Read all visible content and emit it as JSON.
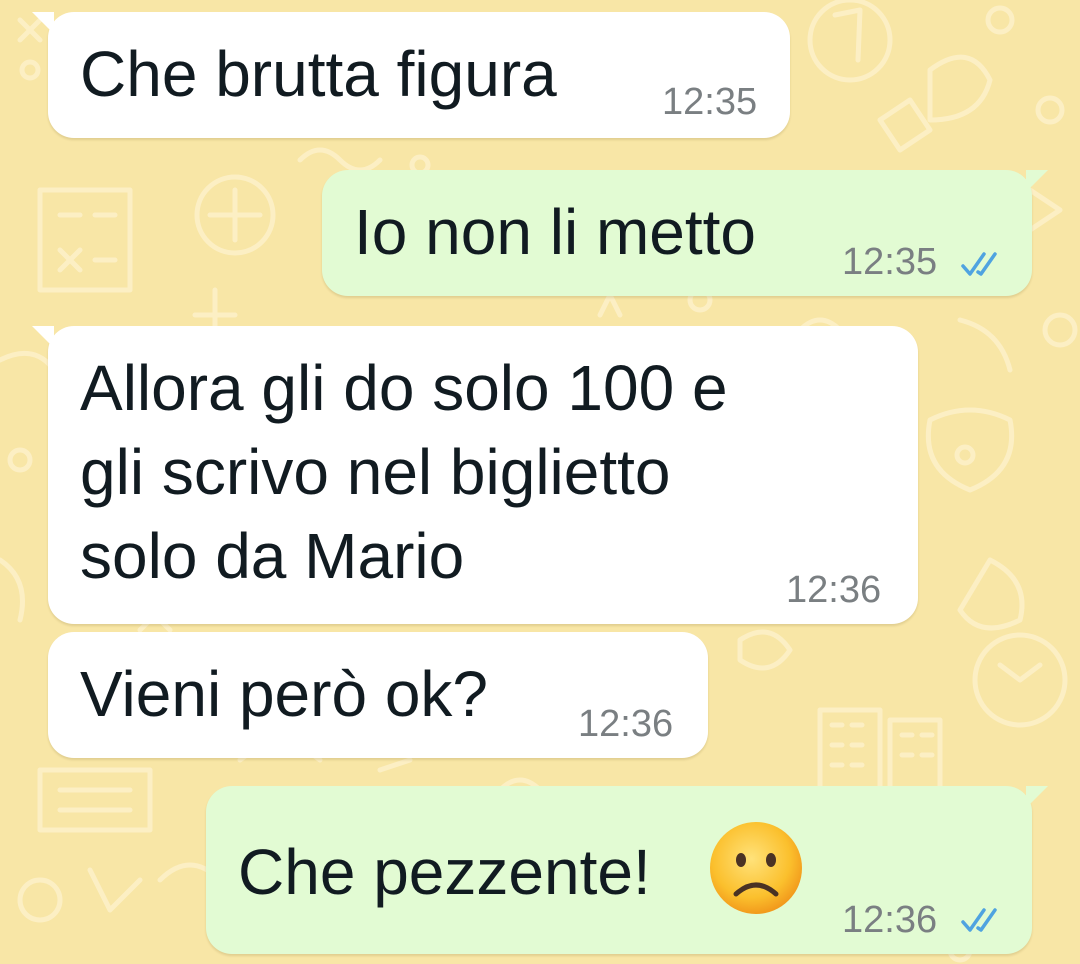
{
  "theme": {
    "wallpaper_color": "#f8e6a6",
    "incoming_bubble_color": "#ffffff",
    "outgoing_bubble_color": "#e2fbd3",
    "read_ticks_color": "#4fa3e0"
  },
  "messages": [
    {
      "direction": "incoming",
      "text": "Che brutta figura",
      "time": "12:35"
    },
    {
      "direction": "outgoing",
      "text": "Io non li metto",
      "time": "12:35",
      "status_icon": "double-check-read-icon"
    },
    {
      "direction": "incoming",
      "text": "Allora gli do solo 100 e\ngli scrivo nel biglietto\nsolo da Mario",
      "time": "12:36"
    },
    {
      "direction": "incoming",
      "text": "Vieni però ok?",
      "time": "12:36"
    },
    {
      "direction": "outgoing",
      "text": "Che pezzente!",
      "emoji": "🙁",
      "emoji_icon": "slightly-frowning-face-icon",
      "time": "12:36",
      "status_icon": "double-check-read-icon"
    }
  ]
}
